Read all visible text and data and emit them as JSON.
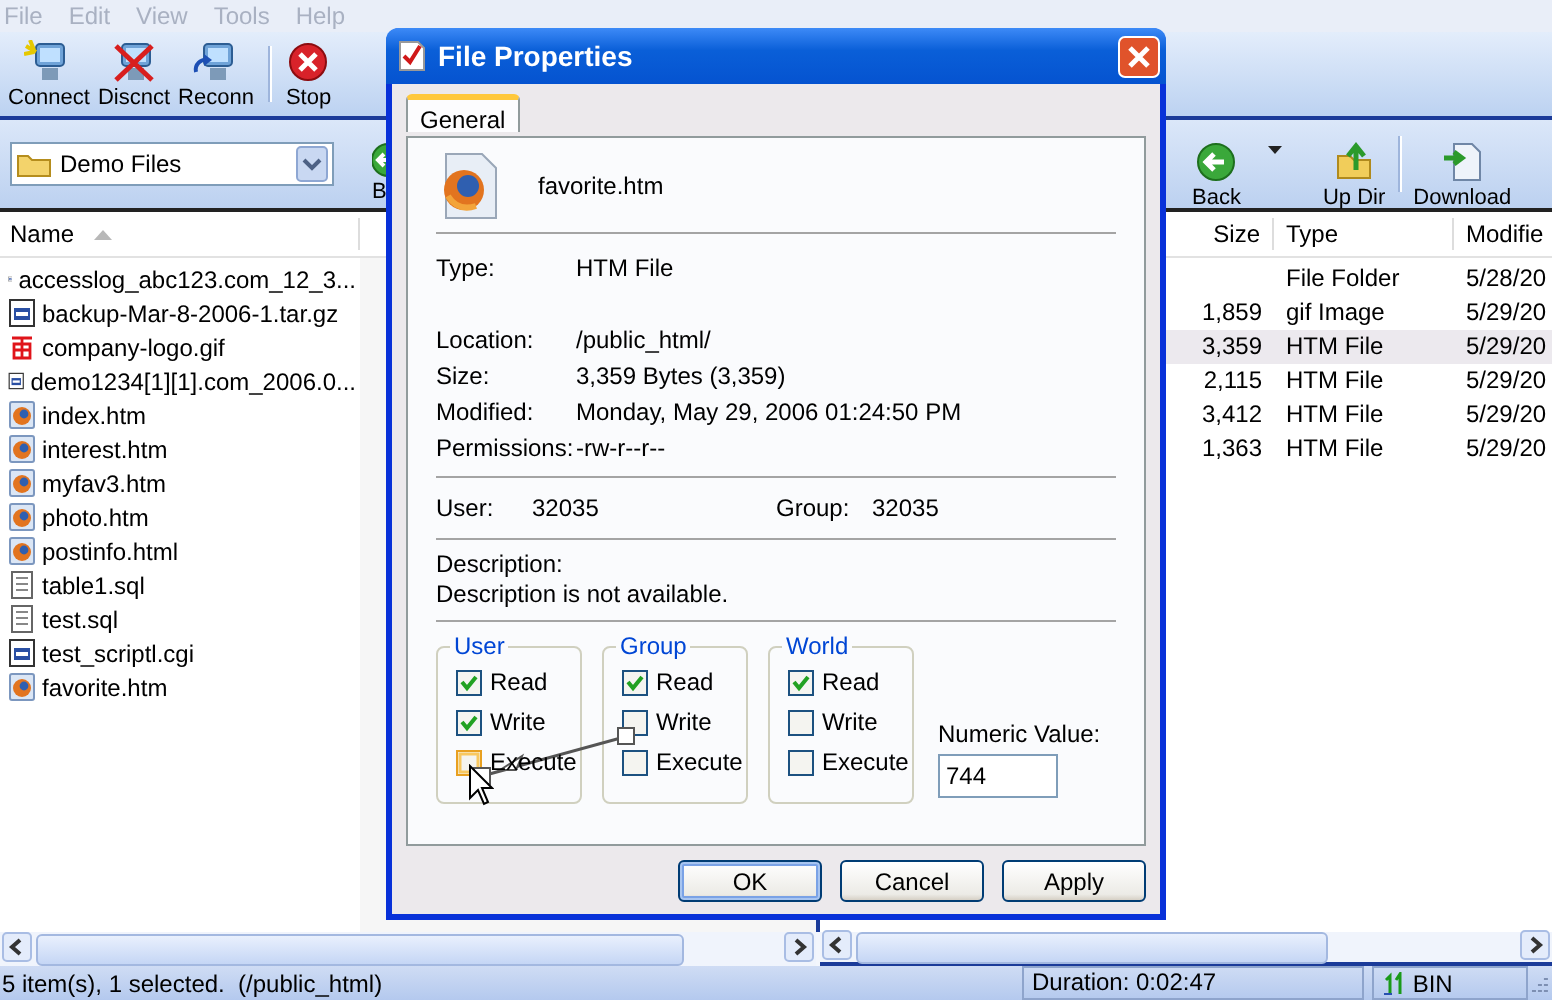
{
  "menu": [
    {
      "label": "File",
      "disabled": true
    },
    {
      "label": "Edit",
      "disabled": true
    },
    {
      "label": "View",
      "disabled": true
    },
    {
      "label": "Tools",
      "disabled": true
    },
    {
      "label": "Help",
      "disabled": true
    }
  ],
  "toolbar": [
    {
      "label": "Connect",
      "kind": "connect"
    },
    {
      "label": "Discnct",
      "kind": "disconnect"
    },
    {
      "label": "Reconn",
      "kind": "reconnect"
    },
    {
      "label": "Stop",
      "kind": "stop"
    }
  ],
  "left_pane": {
    "folder": {
      "value": "Demo Files"
    },
    "toolbar": [
      {
        "label": "B",
        "kind": "back"
      }
    ],
    "column": "Name",
    "files": [
      {
        "name": "accesslog_abc123.com_12_3...",
        "kind": "log"
      },
      {
        "name": "backup-Mar-8-2006-1.tar.gz",
        "kind": "log"
      },
      {
        "name": "company-logo.gif",
        "kind": "image"
      },
      {
        "name": "demo1234[1][1].com_2006.0...",
        "kind": "log"
      },
      {
        "name": "index.htm",
        "kind": "web"
      },
      {
        "name": "interest.htm",
        "kind": "web"
      },
      {
        "name": "myfav3.htm",
        "kind": "web"
      },
      {
        "name": "photo.htm",
        "kind": "web"
      },
      {
        "name": "postinfo.html",
        "kind": "web"
      },
      {
        "name": "table1.sql",
        "kind": "text"
      },
      {
        "name": "test.sql",
        "kind": "text"
      },
      {
        "name": "test_scriptl.cgi",
        "kind": "log"
      },
      {
        "name": "favorite.htm",
        "kind": "web"
      }
    ]
  },
  "right_pane": {
    "toolbar": [
      {
        "label": "Back",
        "kind": "back"
      },
      {
        "label": "Up Dir",
        "kind": "updir"
      },
      {
        "label": "Download",
        "kind": "download"
      }
    ],
    "columns": [
      "Size",
      "Type",
      "Modifie"
    ],
    "rows": [
      {
        "size": "",
        "type": "File Folder",
        "modified": "5/28/20",
        "selected": false
      },
      {
        "size": "1,859",
        "type": "gif Image",
        "modified": "5/29/20",
        "selected": false
      },
      {
        "size": "3,359",
        "type": "HTM File",
        "modified": "5/29/20",
        "selected": true
      },
      {
        "size": "2,115",
        "type": "HTM File",
        "modified": "5/29/20",
        "selected": false
      },
      {
        "size": "3,412",
        "type": "HTM File",
        "modified": "5/29/20",
        "selected": false
      },
      {
        "size": "1,363",
        "type": "HTM File",
        "modified": "5/29/20",
        "selected": false
      }
    ]
  },
  "dialog": {
    "title": "File Properties",
    "tabs": [
      {
        "label": "General",
        "selected": true
      }
    ],
    "file_name": "favorite.htm",
    "type": {
      "label": "Type:",
      "value": "HTM File"
    },
    "properties": [
      {
        "label": "Location:",
        "value": "/public_html/"
      },
      {
        "label": "Size:",
        "value": "3,359 Bytes (3,359)"
      },
      {
        "label": "Modified:",
        "value": "Monday, May 29, 2006 01:24:50 PM"
      },
      {
        "label": "Permissions:",
        "value": "-rw-r--r--"
      }
    ],
    "owner": {
      "user_label": "User:",
      "user": "32035",
      "group_label": "Group:",
      "group": "32035"
    },
    "description": {
      "label": "Description:",
      "text": "Description is not available."
    },
    "permission_groups": [
      {
        "title": "User",
        "items": [
          {
            "label": "Read",
            "checked": true,
            "hot": false
          },
          {
            "label": "Write",
            "checked": true,
            "hot": false
          },
          {
            "label": "Execute",
            "checked": false,
            "hot": true
          }
        ]
      },
      {
        "title": "Group",
        "items": [
          {
            "label": "Read",
            "checked": true,
            "hot": false
          },
          {
            "label": "Write",
            "checked": false,
            "hot": false
          },
          {
            "label": "Execute",
            "checked": false,
            "hot": false
          }
        ]
      },
      {
        "title": "World",
        "items": [
          {
            "label": "Read",
            "checked": true,
            "hot": false
          },
          {
            "label": "Write",
            "checked": false,
            "hot": false
          },
          {
            "label": "Execute",
            "checked": false,
            "hot": false
          }
        ]
      }
    ],
    "numeric": {
      "label": "Numeric Value:",
      "value": "744"
    },
    "buttons": [
      {
        "label": "OK",
        "default": true
      },
      {
        "label": "Cancel",
        "default": false
      },
      {
        "label": "Apply",
        "default": false
      }
    ]
  },
  "status_bar": {
    "text": "5 item(s), 1 selected.  (/public_html)",
    "duration": "Duration: 0:02:47",
    "mode": "BIN"
  }
}
